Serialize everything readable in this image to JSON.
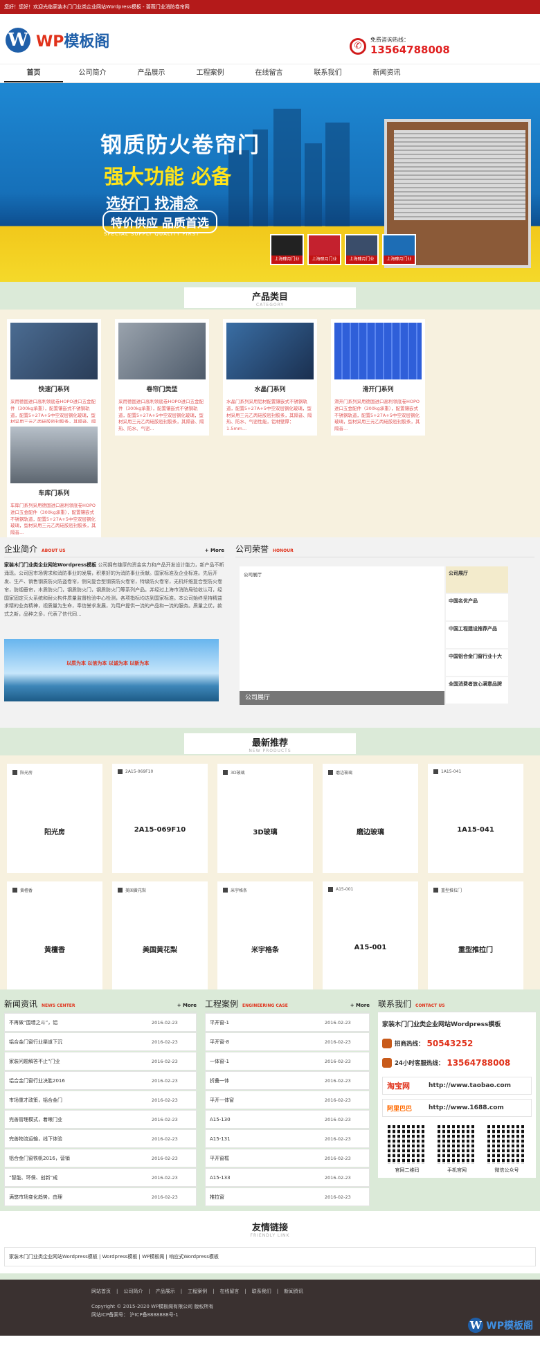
{
  "topbar": {
    "text": "您好！您好！欢迎光临家装木门门业类企业网站Wordpress模板 - 蔷薇门业消防卷帘网"
  },
  "header": {
    "logo_mark": "W",
    "logo_prefix": "WP",
    "logo_name": "模板阁",
    "hotline_label": "免费咨询热线：",
    "hotline_number": "13564788008"
  },
  "nav": {
    "items": [
      {
        "label": "首页"
      },
      {
        "label": "公司简介"
      },
      {
        "label": "产品展示"
      },
      {
        "label": "工程案例"
      },
      {
        "label": "在线留言"
      },
      {
        "label": "联系我们"
      },
      {
        "label": "新闻资讯"
      }
    ]
  },
  "banner": {
    "title": "钢质防火卷帘门",
    "sub1": "强大功能 必备",
    "sub2": "选好门 找浦念",
    "sub3": "特价供应 品质首选",
    "en": "SPECIAL SUPPLY QUALITY FIRST",
    "thumbs": [
      "上海肆月门业",
      "上海肆月门业",
      "上海肆月门业",
      "上海肆月门业"
    ]
  },
  "products_section": {
    "title": "产品类目",
    "en": "CATEGORY"
  },
  "products": [
    {
      "name": "快速门系列",
      "desc": "采用德国进口高利领底卷HOPO进口五金配件（300kg承重），配置镶嵌式不锈钢轨道，配置5+27A+5中空双层钢化玻璃，型材采用三元乙丙硅胶密封胶条，其隔音、隔热、防水、气密..."
    },
    {
      "name": "卷帘门类型",
      "desc": "采用德国进口高利领底卷HOPO进口五金配件（300kg承重），配置镶嵌式不锈钢轨道，配置5+27A+5中空双层钢化玻璃，型材采用三元乙丙硅胶密封胶条，其隔音、隔热、防水、气密..."
    },
    {
      "name": "水晶门系列",
      "desc": "水晶门系列采用铝材配置镶嵌式不锈钢轨道，配置5+27A+5中空双层钢化玻璃，型材采用三元乙丙硅胶密封胶条，其隔音、隔热、防水、气密性能，铝材壁厚：1.5mm..."
    },
    {
      "name": "滑开门系列",
      "desc": "滑开门系列采用德国进口高利领底卷HOPO进口五金配件（300kg承重），配置镶嵌式不锈钢轨道，配置5+27A+5中空双层钢化玻璃，型材采用三元乙丙硅胶密封胶条，其隔音..."
    },
    {
      "name": "车库门系列",
      "desc": "车库门系列采用德国进口高利领底卷HOPO进口五金配件（300kg承重），配置镶嵌式不锈钢轨道，配置5+27A+5中空双层钢化玻璃，型材采用三元乙丙硅胶密封胶条，其隔音..."
    }
  ],
  "about": {
    "title": "企业简介",
    "en": "ABOUT US",
    "more": "+ More",
    "company": "家装木门门业类企业网站Wordpress模板",
    "text": "公司拥有雄厚的资金实力和产品开发设计能力，新产品不断涌现。公司因市场需求和消防事业的发展，积累好的为消防事业贡献。国家标准及企业标准。先后开发、生产、销售钢质防火防盗卷帘，侧向复合型钢质防火卷帘，特级防火卷帘，无机纤维复合型防火卷帘，防烟垂帘，木质防火门，钢质防火门，钢质防火门等系列产品。并经过上海市消防局验收认可，经国家固定灭火系统和耐火构件质量监督检验中心检测，各项指标均达到国家标准。本公司始终坚持精益求精的业务精神，视质量为生命，奉信誉求发展，为用户提供一流的产品和一流的服务。质量之优，款式之新，品种之多，代表了信代同...",
    "slogan": "以质为本 以信为本 以诚为本 以新为本"
  },
  "honor": {
    "title": "公司荣誉",
    "en": "HONOUR",
    "main_tag": "公司展厅",
    "main_caption": "公司展厅",
    "items": [
      {
        "label": "公司展厅"
      },
      {
        "label": "中国名优产品"
      },
      {
        "label": "中国工程建设推荐产品"
      },
      {
        "label": "中国铝合金门窗行业十大"
      },
      {
        "label": "全国消费者放心满意品牌"
      }
    ]
  },
  "newp_section": {
    "title": "最新推荐",
    "en": "NEW PRODUCTS"
  },
  "new_products": [
    {
      "small": "阳光房",
      "title": "阳光房"
    },
    {
      "small": "2A15-069F10",
      "title": "2A15-069F10"
    },
    {
      "small": "3D玻璃",
      "title": "3D玻璃"
    },
    {
      "small": "磨边玻璃",
      "title": "磨边玻璃"
    },
    {
      "small": "1A15-041",
      "title": "1A15-041"
    },
    {
      "small": "黄檀香",
      "title": "黄檀香"
    },
    {
      "small": "美国黄花梨",
      "title": "美国黄花梨"
    },
    {
      "small": "米宇格条",
      "title": "米宇格条"
    },
    {
      "small": "A15-001",
      "title": "A15-001"
    },
    {
      "small": "重型推拉门",
      "title": "重型推拉门"
    }
  ],
  "news": {
    "title": "新闻资讯",
    "en": "NEWS CENTER",
    "more": "+ More",
    "rows": [
      {
        "t": "不再做“围墙之斗”，铝",
        "d": "2016-02-23"
      },
      {
        "t": "铝合金门窗行业渠道下沉",
        "d": "2016-02-23"
      },
      {
        "t": "家装问题解答不止”门业",
        "d": "2016-02-23"
      },
      {
        "t": "铝合金门窗行业决胜2016",
        "d": "2016-02-23"
      },
      {
        "t": "市场重才政策，铝合金门",
        "d": "2016-02-23"
      },
      {
        "t": "完善管理模式，着眼门业",
        "d": "2016-02-23"
      },
      {
        "t": "完善物流运输，线下体验",
        "d": "2016-02-23"
      },
      {
        "t": "铝合金门窗铁帆2016，营销",
        "d": "2016-02-23"
      },
      {
        "t": "“智能、环保、创新”成",
        "d": "2016-02-23"
      },
      {
        "t": "满悠市场变化趋势，由理",
        "d": "2016-02-23"
      }
    ]
  },
  "cases": {
    "title": "工程案例",
    "en": "ENGINEERING CASE",
    "more": "+ More",
    "rows": [
      {
        "t": "平开窗-1",
        "d": "2016-02-23"
      },
      {
        "t": "平开窗-8",
        "d": "2016-02-23"
      },
      {
        "t": "一体窗-1",
        "d": "2016-02-23"
      },
      {
        "t": "折叠一体",
        "d": "2016-02-23"
      },
      {
        "t": "平开一体窗",
        "d": "2016-02-23"
      },
      {
        "t": "A15-130",
        "d": "2016-02-23"
      },
      {
        "t": "A15-131",
        "d": "2016-02-23"
      },
      {
        "t": "平开窗框",
        "d": "2016-02-23"
      },
      {
        "t": "A15-133",
        "d": "2016-02-23"
      },
      {
        "t": "推拉窗",
        "d": "2016-02-23"
      }
    ]
  },
  "contact": {
    "title": "联系我们",
    "en": "CONTACT US",
    "company": "家装木门门业类企业网站Wordpress模板",
    "hotline_label": "招商热线：",
    "hotline": "50543252",
    "service_label": "24小时客服热线：",
    "service": "13564788008",
    "taobao_brand": "淘宝网",
    "taobao_url": "http://www.taobao.com",
    "alibaba_brand": "阿里巴巴",
    "alibaba_url": "http://www.1688.com",
    "qrs": [
      {
        "label": "官网二维码"
      },
      {
        "label": "手机官网"
      },
      {
        "label": "微信公众号"
      }
    ]
  },
  "friends": {
    "title": "友情链接",
    "en": "FRIENDLY LINK",
    "links": "家装木门门业类企业网站Wordpress模板 | Wordpress模板 | WP模板阁 | 响应式Wordpress模板"
  },
  "footer": {
    "nav": [
      "网站首页",
      "公司简介",
      "产品展示",
      "工程案例",
      "在线留言",
      "联系我们",
      "新闻资讯"
    ],
    "copyright": "Copyright © 2015-2020 WP模板阁有限公司 版权所有",
    "icp": "网站ICP备案号： 沪ICP备8888888号-1",
    "logo_mark": "W",
    "logo_text": "WP模板阁"
  },
  "colors": {
    "accent_red": "#b41a1a",
    "brand_blue": "#1f5fa9",
    "section_green": "#dbead8",
    "cream": "#f7f1df"
  }
}
